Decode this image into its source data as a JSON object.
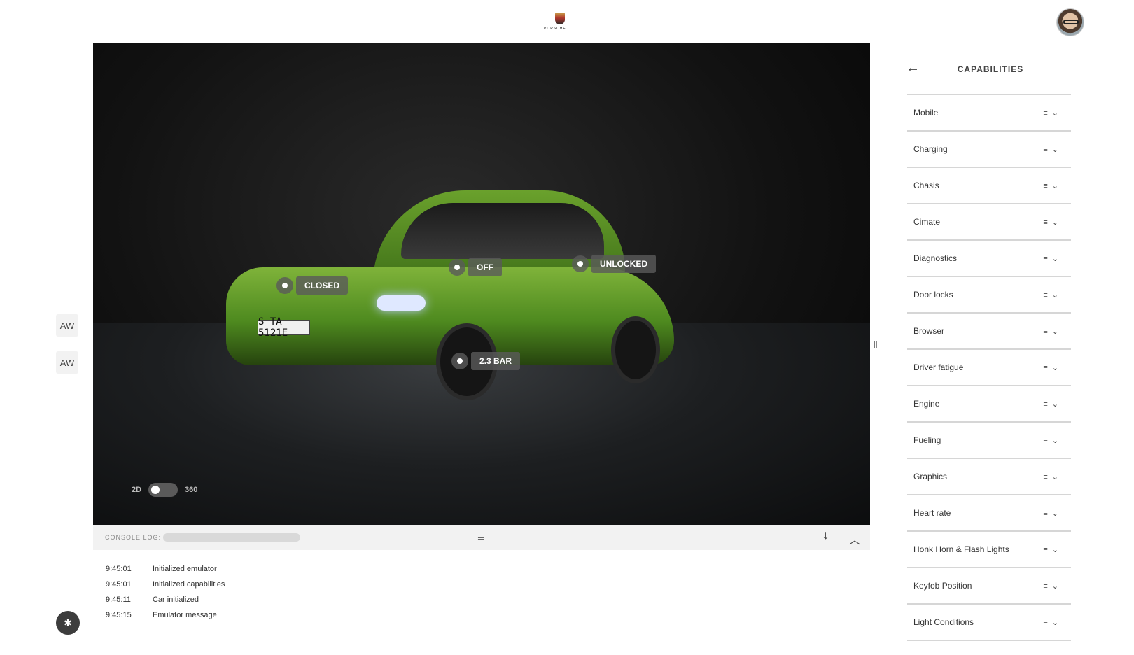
{
  "header": {
    "logo_text": "PORSCHE"
  },
  "left_rail": {
    "aw_1": "AW",
    "aw_2": "AW",
    "bluetooth_glyph": "✱"
  },
  "viewer": {
    "plate": "S TA 5121E",
    "tags": {
      "closed": "CLOSED",
      "off": "OFF",
      "unlocked": "UNLOCKED",
      "pressure": "2.3 BAR"
    },
    "mode_left": "2D",
    "mode_right": "360"
  },
  "console": {
    "label": "CONSOLE LOG:",
    "logs": [
      {
        "time": "9:45:01",
        "message": "Initialized emulator"
      },
      {
        "time": "9:45:01",
        "message": "Initialized capabilities"
      },
      {
        "time": "9:45:11",
        "message": "Car initialized"
      },
      {
        "time": "9:45:15",
        "message": "Emulator message"
      }
    ]
  },
  "panel": {
    "title": "CAPABILITIES",
    "items": [
      "Mobile",
      "Charging",
      "Chasis",
      "Cimate",
      "Diagnostics",
      "Door locks",
      "Browser",
      "Driver fatigue",
      "Engine",
      "Fueling",
      "Graphics",
      "Heart rate",
      "Honk Horn & Flash Lights",
      "Keyfob Position",
      "Light Conditions"
    ]
  }
}
